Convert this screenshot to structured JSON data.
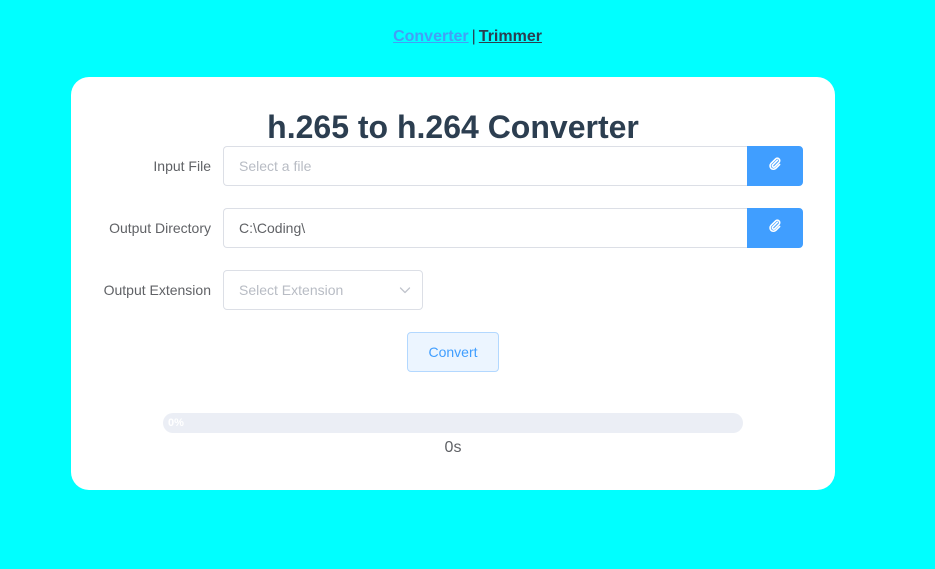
{
  "nav": {
    "converter_label": "Converter",
    "separator": "|",
    "trimmer_label": "Trimmer"
  },
  "title": "h.265 to h.264 Converter",
  "form": {
    "input_file": {
      "label": "Input File",
      "value": "",
      "placeholder": "Select a file",
      "button_icon": "paperclip-icon"
    },
    "output_directory": {
      "label": "Output Directory",
      "value": "C:\\Coding\\",
      "placeholder": "",
      "button_icon": "paperclip-icon"
    },
    "output_extension": {
      "label": "Output Extension",
      "placeholder": "Select Extension",
      "arrow_icon": "chevron-down-icon"
    }
  },
  "convert_label": "Convert",
  "progress": {
    "percent": 0,
    "text": "0%"
  },
  "elapsed": "0s",
  "colors": {
    "background": "#00ffff",
    "accent": "#409eff",
    "nav_active": "#42a0f5",
    "text_dark": "#2c3e50"
  }
}
